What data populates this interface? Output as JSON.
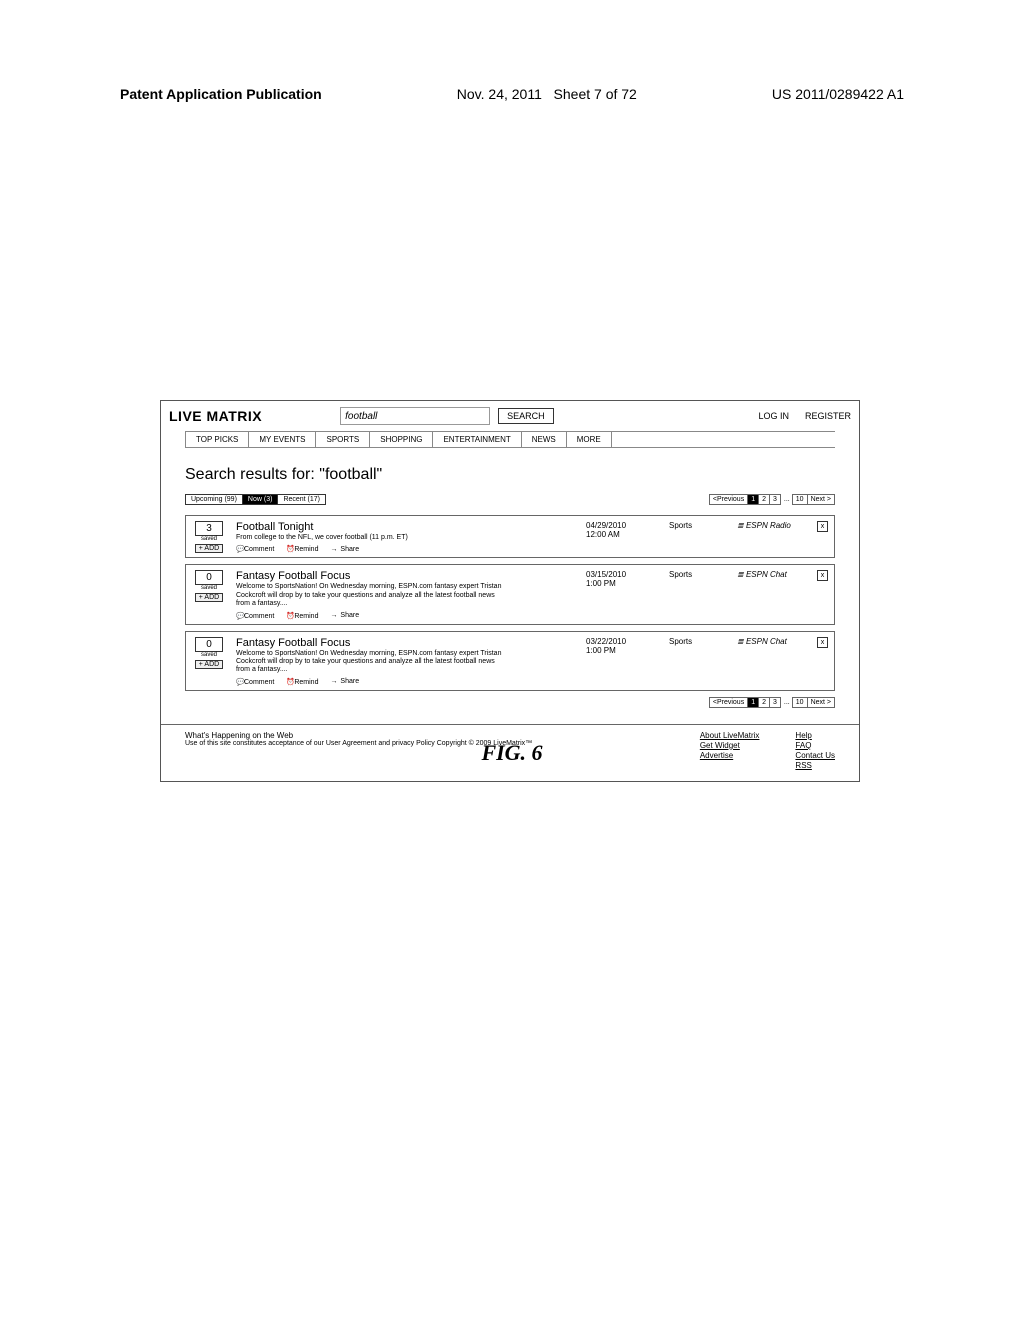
{
  "doc_header": {
    "title": "Patent Application Publication",
    "date": "Nov. 24, 2011",
    "sheet": "Sheet 7 of 72",
    "pubno": "US 2011/0289422 A1"
  },
  "figure_label": "FIG. 6",
  "brand": "LIVE MATRIX",
  "search": {
    "value": "football",
    "button": "SEARCH"
  },
  "auth": {
    "login": "LOG IN",
    "register": "REGISTER"
  },
  "nav": [
    "TOP PICKS",
    "MY EVENTS",
    "SPORTS",
    "SHOPPING",
    "ENTERTAINMENT",
    "NEWS",
    "MORE"
  ],
  "heading_prefix": "Search results for:  ",
  "heading_term": "\"football\"",
  "filters": {
    "items": [
      {
        "label": "Upcoming (99)",
        "active": false
      },
      {
        "label": "Now (3)",
        "active": true
      },
      {
        "label": "Recent (17)",
        "active": false
      }
    ]
  },
  "pager": {
    "prev": "<Previous",
    "pages": [
      "1",
      "2",
      "3"
    ],
    "active": "1",
    "ellipsis": "...",
    "last": "10",
    "next": "Next >"
  },
  "results": [
    {
      "saved_count": "3",
      "saved_label": "saved",
      "add_label": "+ ADD",
      "title": "Football Tonight",
      "desc": "From college to the NFL, we cover football (11 p.m. ET)",
      "date": "04/29/2010",
      "time": "12:00 AM",
      "category": "Sports",
      "source": "ESPN Radio",
      "close": "x"
    },
    {
      "saved_count": "0",
      "saved_label": "saved",
      "add_label": "+ ADD",
      "title": "Fantasy Football Focus",
      "desc": "Welcome to SportsNation!  On Wednesday morning, ESPN.com fantasy expert Tristan Cockcroft will drop by to take your questions and analyze all the latest football news from a fantasy....",
      "date": "03/15/2010",
      "time": "1:00 PM",
      "category": "Sports",
      "source": "ESPN Chat",
      "close": "x"
    },
    {
      "saved_count": "0",
      "saved_label": "saved",
      "add_label": "+ ADD",
      "title": "Fantasy Football Focus",
      "desc": "Welcome to SportsNation!  On Wednesday morning, ESPN.com fantasy expert Tristan Cockcroft will drop by to take your questions and analyze all the latest football news from a fantasy....",
      "date": "03/22/2010",
      "time": "1:00 PM",
      "category": "Sports",
      "source": "ESPN Chat",
      "close": "x"
    }
  ],
  "actions": {
    "comment": "Comment",
    "remind": "Remind",
    "share": "Share"
  },
  "footer": {
    "tagline": "What's Happening on the Web",
    "legal": "Use of this site constitutes acceptance of our User Agreement and privacy Policy Copyright © 2009 LiveMatrix™",
    "links_a": [
      "About LiveMatrix",
      "Get Widget",
      "Advertise"
    ],
    "links_b": [
      "Help",
      "FAQ",
      "Contact Us",
      "RSS"
    ]
  },
  "icons": {
    "comment": "💬",
    "remind": "⏰",
    "share": "→",
    "source": "≣"
  }
}
